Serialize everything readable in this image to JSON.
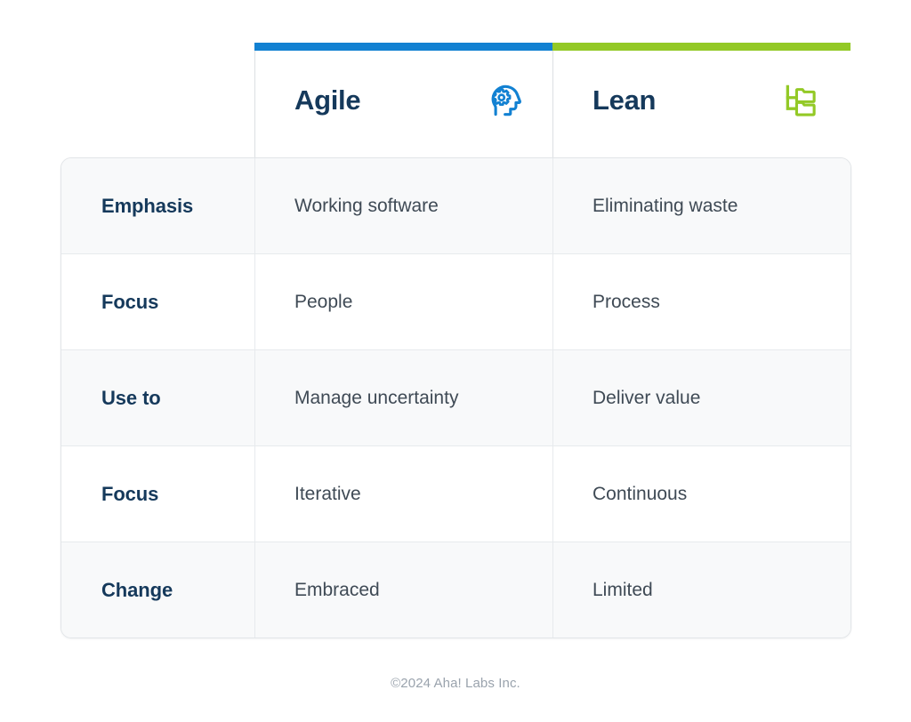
{
  "table": {
    "label_column_header": "",
    "columns": [
      {
        "id": "agile",
        "title": "Agile",
        "accent_color": "#1281D2",
        "icon": "head-gear-icon"
      },
      {
        "id": "lean",
        "title": "Lean",
        "accent_color": "#93C926",
        "icon": "folder-tree-icon"
      }
    ],
    "rows": [
      {
        "label": "Emphasis",
        "agile": "Working software",
        "lean": "Eliminating waste",
        "shaded": true
      },
      {
        "label": "Focus",
        "agile": "People",
        "lean": "Process",
        "shaded": false
      },
      {
        "label": "Use to",
        "agile": "Manage uncertainty",
        "lean": "Deliver value",
        "shaded": true
      },
      {
        "label": "Focus",
        "agile": "Iterative",
        "lean": "Continuous",
        "shaded": false
      },
      {
        "label": "Change",
        "agile": "Embraced",
        "lean": "Limited",
        "shaded": true
      }
    ]
  },
  "footer": {
    "copyright": "©2024 Aha! Labs Inc."
  },
  "colors": {
    "accent_blue": "#1281D2",
    "accent_green": "#93C926",
    "heading_navy": "#15395B",
    "body_text": "#3f4a55",
    "row_shaded": "#f8f9fa",
    "row_plain": "#ffffff",
    "border": "#e7eaed",
    "footer_text": "#9aa3ad"
  }
}
